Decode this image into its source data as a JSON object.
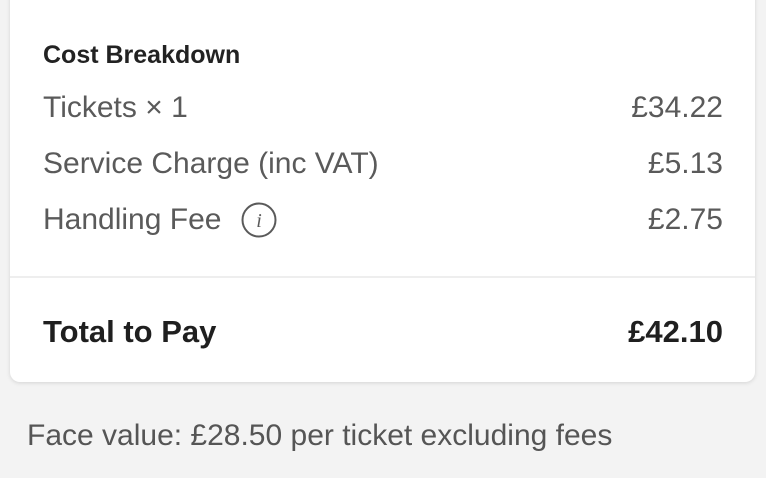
{
  "cost_breakdown": {
    "title": "Cost Breakdown",
    "rows": [
      {
        "label": "Tickets × 1",
        "amount": "£34.22"
      },
      {
        "label": "Service Charge (inc VAT)",
        "amount": "£5.13"
      },
      {
        "label": "Handling Fee",
        "amount": "£2.75",
        "icon": "info-icon"
      }
    ],
    "total": {
      "label": "Total to Pay",
      "amount": "£42.10"
    }
  },
  "footnote": "Face value: £28.50 per ticket excluding fees",
  "colors": {
    "page_background": "#f3f3f3",
    "card_background": "#ffffff",
    "text_primary": "#222222",
    "text_secondary": "#5a5a5a"
  }
}
